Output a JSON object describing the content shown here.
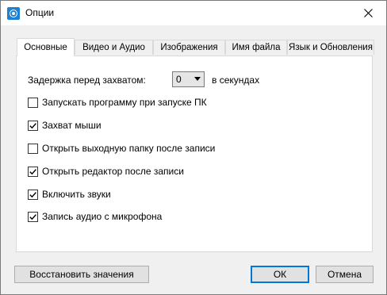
{
  "window": {
    "title": "Опции"
  },
  "tabs": [
    {
      "label": "Основные",
      "active": true
    },
    {
      "label": "Видео и Аудио",
      "active": false
    },
    {
      "label": "Изображения",
      "active": false
    },
    {
      "label": "Имя файла",
      "active": false
    },
    {
      "label": "Язык и Обновления",
      "active": false
    }
  ],
  "general": {
    "delay_label": "Задержка перед захватом:",
    "delay_value": "0",
    "delay_unit": "в секундах",
    "options": [
      {
        "label": "Запускать программу при запуске ПК",
        "checked": false
      },
      {
        "label": "Захват мыши",
        "checked": true
      },
      {
        "label": "Открыть выходную папку после записи",
        "checked": false
      },
      {
        "label": "Открыть редактор после записи",
        "checked": true
      },
      {
        "label": "Включить звуки",
        "checked": true
      },
      {
        "label": "Запись аудио с микрофона",
        "checked": true
      }
    ]
  },
  "footer": {
    "restore_label": "Восстановить значения",
    "ok_label": "ОК",
    "cancel_label": "Отмена"
  },
  "icons": {
    "app": "screen-recorder-icon",
    "close": "close-icon",
    "dropdown": "chevron-down-icon",
    "check": "checkmark-icon"
  },
  "colors": {
    "accent": "#0078d7",
    "dialog_bg": "#f0f0f0",
    "panel_bg": "#ffffff"
  }
}
